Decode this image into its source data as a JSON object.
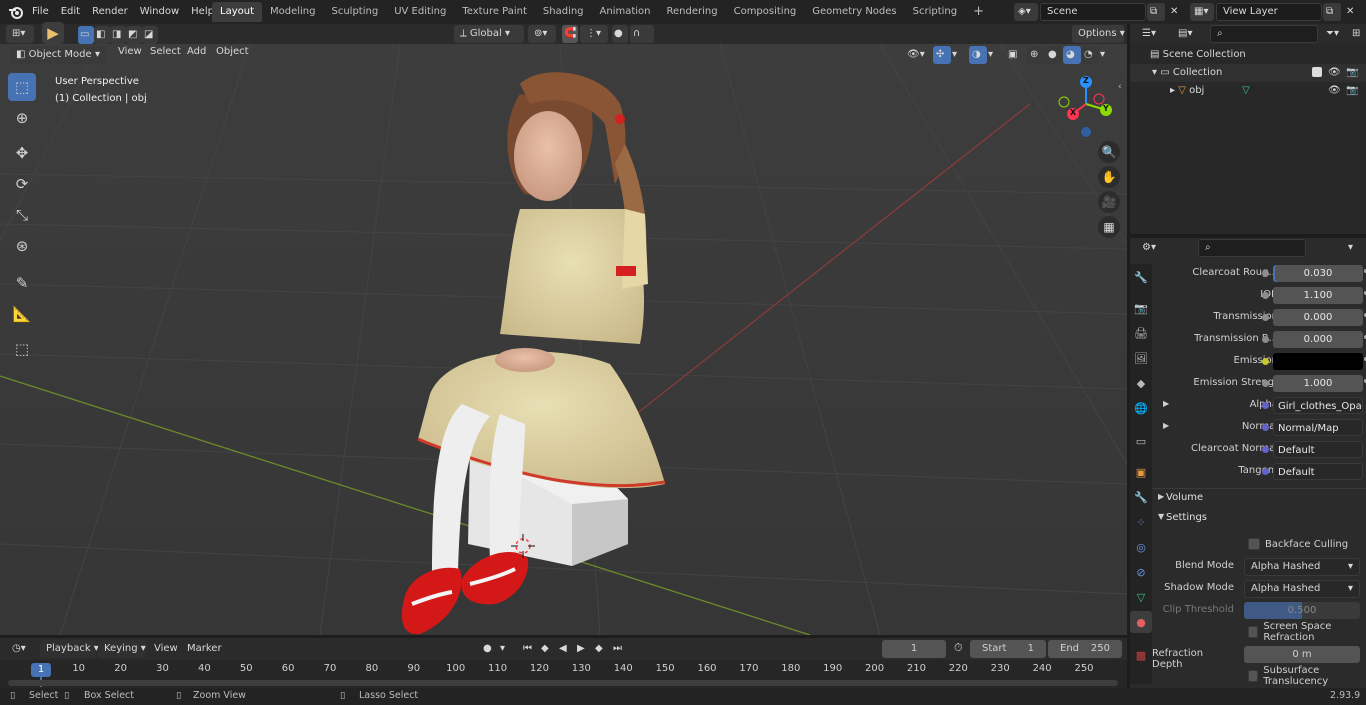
{
  "topbar": {
    "menus": [
      "File",
      "Edit",
      "Render",
      "Window",
      "Help"
    ],
    "workspaces": [
      "Layout",
      "Modeling",
      "Sculpting",
      "UV Editing",
      "Texture Paint",
      "Shading",
      "Animation",
      "Rendering",
      "Compositing",
      "Geometry Nodes",
      "Scripting"
    ],
    "active_workspace": "Layout",
    "scene": "Scene",
    "view_layer": "View Layer"
  },
  "viewport": {
    "mode": "Object Mode",
    "menus": [
      "View",
      "Select",
      "Add",
      "Object"
    ],
    "orientation": "Global",
    "options_label": "Options",
    "overlay_title": "User Perspective",
    "overlay_subtitle": "(1) Collection | obj",
    "gizmo": {
      "x": "X",
      "y": "Y",
      "z": "Z"
    }
  },
  "outliner": {
    "search_placeholder": "",
    "rows": [
      {
        "label": "Scene Collection",
        "indent": 0
      },
      {
        "label": "Collection",
        "indent": 1
      },
      {
        "label": "obj",
        "indent": 2
      }
    ]
  },
  "properties": {
    "rows": [
      {
        "label": "Clearcoat Roug...",
        "value": "0.030",
        "socket": "#8c8c8c",
        "kind": "num"
      },
      {
        "label": "IOR",
        "value": "1.100",
        "socket": "#8c8c8c",
        "kind": "num"
      },
      {
        "label": "Transmission",
        "value": "0.000",
        "socket": "#8c8c8c",
        "kind": "num"
      },
      {
        "label": "Transmission R...",
        "value": "0.000",
        "socket": "#8c8c8c",
        "kind": "num"
      },
      {
        "label": "Emission",
        "value": "",
        "socket": "#c7c729",
        "kind": "color"
      },
      {
        "label": "Emission Strengt",
        "value": "1.000",
        "socket": "#8c8c8c",
        "kind": "num"
      },
      {
        "label": "Alpha",
        "value": "Girl_clothes_Opacity...",
        "socket": "#6363c7",
        "kind": "link",
        "expand": true
      },
      {
        "label": "Normal",
        "value": "Normal/Map",
        "socket": "#6363c7",
        "kind": "link",
        "expand": true
      },
      {
        "label": "Clearcoat Normal",
        "value": "Default",
        "socket": "#6363c7",
        "kind": "link"
      },
      {
        "label": "Tangent",
        "value": "Default",
        "socket": "#6363c7",
        "kind": "link"
      }
    ],
    "sections": {
      "volume": "Volume",
      "settings": "Settings"
    },
    "settings": {
      "backface_culling": "Backface Culling",
      "blend_mode_label": "Blend Mode",
      "blend_mode": "Alpha Hashed",
      "shadow_mode_label": "Shadow Mode",
      "shadow_mode": "Alpha Hashed",
      "clip_threshold_label": "Clip Threshold",
      "clip_threshold": "0.500",
      "screen_space_refraction": "Screen Space Refraction",
      "refraction_depth_label": "Refraction Depth",
      "refraction_depth": "0 m",
      "subsurface_translucency": "Subsurface Translucency"
    }
  },
  "timeline": {
    "menus": [
      "Playback",
      "Keying",
      "View",
      "Marker"
    ],
    "current_frame": "1",
    "start_label": "Start",
    "start": "1",
    "end_label": "End",
    "end": "250",
    "ticks": [
      "1",
      "10",
      "20",
      "30",
      "40",
      "50",
      "60",
      "70",
      "80",
      "90",
      "100",
      "110",
      "120",
      "130",
      "140",
      "150",
      "160",
      "170",
      "180",
      "190",
      "200",
      "210",
      "220",
      "230",
      "240",
      "250"
    ]
  },
  "statusbar": {
    "select": "Select",
    "box_select": "Box Select",
    "zoom_view": "Zoom View",
    "lasso_select": "Lasso Select",
    "version": "2.93.9"
  },
  "colors": {
    "accent": "#4772b3",
    "active_tab": "#3d3d3d",
    "x_axis": "#ff3352",
    "y_axis": "#8bdc00",
    "z_axis": "#2890ff"
  }
}
